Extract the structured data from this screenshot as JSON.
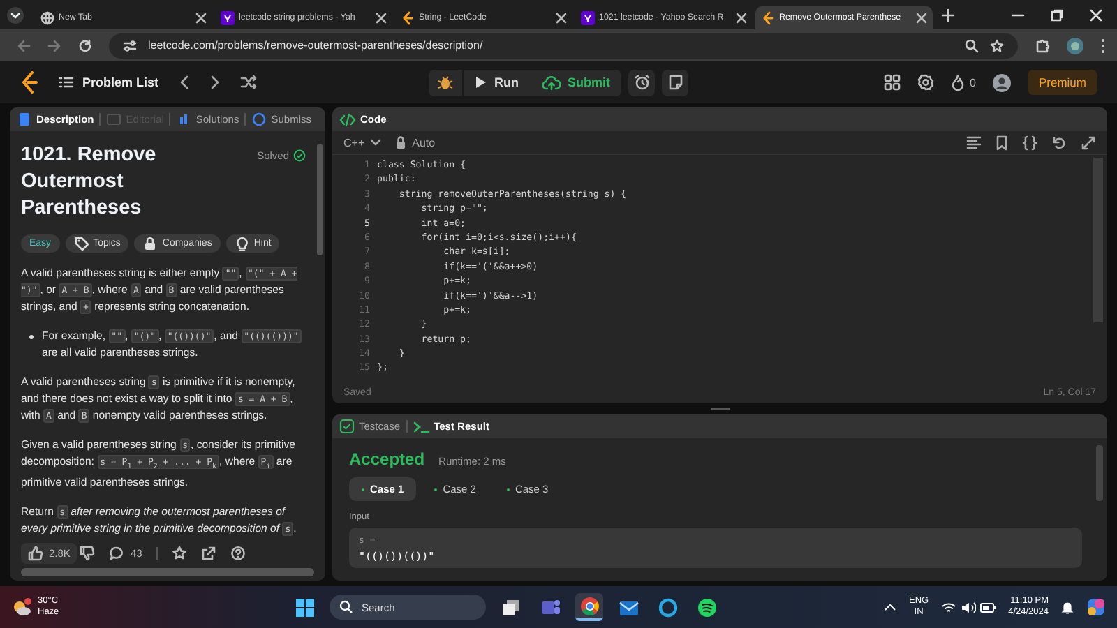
{
  "browser": {
    "tabs": [
      {
        "title": "New Tab",
        "kind": "globe",
        "selected": false
      },
      {
        "title": "leetcode string problems - Yah",
        "kind": "yahoo",
        "selected": false
      },
      {
        "title": "String - LeetCode",
        "kind": "leetcode",
        "selected": false
      },
      {
        "title": "1021 leetcode - Yahoo Search R",
        "kind": "yahoo",
        "selected": false
      },
      {
        "title": "Remove Outermost Parenthese",
        "kind": "leetcode",
        "selected": true
      }
    ],
    "url": "leetcode.com/problems/remove-outermost-parentheses/description/"
  },
  "nav": {
    "problem_list": "Problem List",
    "run": "Run",
    "submit": "Submit",
    "streak": "0",
    "premium": "Premium"
  },
  "description_panel": {
    "tabs": [
      {
        "label": "Description",
        "kind": "description",
        "selected": true,
        "disabled": false
      },
      {
        "label": "Editorial",
        "kind": "editorial",
        "selected": false,
        "disabled": true
      },
      {
        "label": "Solutions",
        "kind": "solutions",
        "selected": false,
        "disabled": false
      },
      {
        "label": "Submiss",
        "kind": "submissions",
        "selected": false,
        "disabled": false
      }
    ],
    "title": "1021. Remove Outermost Parentheses",
    "status": "Solved",
    "difficulty": "Easy",
    "tags": [
      {
        "label": "Topics",
        "kind": "topics"
      },
      {
        "label": "Companies",
        "kind": "companies"
      },
      {
        "label": "Hint",
        "kind": "hint"
      }
    ],
    "paragraphs": [
      {
        "kind": "paragraph",
        "segments": [
          {
            "kind": "text",
            "text": "A valid parentheses string is either empty "
          },
          {
            "kind": "code",
            "text": "\"\""
          },
          {
            "kind": "text",
            "text": ", "
          },
          {
            "kind": "code",
            "text": "\"(\" + A + \")\""
          },
          {
            "kind": "text",
            "text": ", or "
          },
          {
            "kind": "code",
            "text": "A + B"
          },
          {
            "kind": "text",
            "text": ", where "
          },
          {
            "kind": "code",
            "text": "A"
          },
          {
            "kind": "text",
            "text": " and "
          },
          {
            "kind": "code",
            "text": "B"
          },
          {
            "kind": "text",
            "text": " are valid parentheses strings, and "
          },
          {
            "kind": "code",
            "text": "+"
          },
          {
            "kind": "text",
            "text": " represents string concatenation."
          }
        ]
      },
      {
        "kind": "bullet",
        "segments": [
          {
            "kind": "text",
            "text": "For example, "
          },
          {
            "kind": "code",
            "text": "\"\""
          },
          {
            "kind": "text",
            "text": ", "
          },
          {
            "kind": "code",
            "text": "\"()\""
          },
          {
            "kind": "text",
            "text": ", "
          },
          {
            "kind": "code",
            "text": "\"(())()\""
          },
          {
            "kind": "text",
            "text": ", and "
          },
          {
            "kind": "code",
            "text": "\"(()(()))\""
          },
          {
            "kind": "text",
            "text": " are all valid parentheses strings."
          }
        ]
      },
      {
        "kind": "paragraph",
        "segments": [
          {
            "kind": "text",
            "text": "A valid parentheses string "
          },
          {
            "kind": "code",
            "text": "s"
          },
          {
            "kind": "text",
            "text": " is primitive if it is nonempty, and there does not exist a way to split it into "
          },
          {
            "kind": "code",
            "text": "s = A + B"
          },
          {
            "kind": "text",
            "text": ", with "
          },
          {
            "kind": "code",
            "text": "A"
          },
          {
            "kind": "text",
            "text": " and "
          },
          {
            "kind": "code",
            "text": "B"
          },
          {
            "kind": "text",
            "text": " nonempty valid parentheses strings."
          }
        ]
      },
      {
        "kind": "paragraph",
        "segments": [
          {
            "kind": "text",
            "text": "Given a valid parentheses string "
          },
          {
            "kind": "code",
            "text": "s"
          },
          {
            "kind": "text",
            "text": ", consider its primitive decomposition: "
          },
          {
            "kind": "code",
            "text": "s = P$_{1}$ + P$_{2}$ + ... + P$_{k}$"
          },
          {
            "kind": "text",
            "text": ", where "
          },
          {
            "kind": "code",
            "text": "P$_{i}$"
          },
          {
            "kind": "text",
            "text": " are primitive valid parentheses strings."
          }
        ]
      },
      {
        "kind": "paragraph",
        "segments": [
          {
            "kind": "text",
            "text": "Return "
          },
          {
            "kind": "code",
            "text": "s"
          },
          {
            "kind": "italic",
            "text": " after removing the outermost parentheses of every primitive string in the primitive decomposition of "
          },
          {
            "kind": "code",
            "text": "s"
          },
          {
            "kind": "text",
            "text": "."
          }
        ]
      }
    ],
    "likes": "2.8K",
    "comments": "43"
  },
  "code_panel": {
    "title": "Code",
    "language": "C++",
    "mode": "Auto",
    "lines": [
      {
        "number": "1",
        "text": "class Solution {",
        "current": false
      },
      {
        "number": "2",
        "text": "public:",
        "current": false
      },
      {
        "number": "3",
        "text": "    string removeOuterParentheses(string s) {",
        "current": false
      },
      {
        "number": "4",
        "text": "        string p=\"\";",
        "current": false
      },
      {
        "number": "5",
        "text": "        int a=0;",
        "current": true
      },
      {
        "number": "6",
        "text": "        for(int i=0;i<s.size();i++){",
        "current": false
      },
      {
        "number": "7",
        "text": "            char k=s[i];",
        "current": false
      },
      {
        "number": "8",
        "text": "            if(k=='('&&a++>0)",
        "current": false
      },
      {
        "number": "9",
        "text": "            p+=k;",
        "current": false
      },
      {
        "number": "10",
        "text": "            if(k==')'&&a-->1)",
        "current": false
      },
      {
        "number": "11",
        "text": "            p+=k;",
        "current": false
      },
      {
        "number": "12",
        "text": "        }",
        "current": false
      },
      {
        "number": "13",
        "text": "        return p;",
        "current": false
      },
      {
        "number": "14",
        "text": "    }",
        "current": false
      },
      {
        "number": "15",
        "text": "};",
        "current": false
      }
    ],
    "status": "Saved",
    "cursor": "Ln 5, Col 17"
  },
  "result_panel": {
    "tabs": [
      {
        "label": "Testcase",
        "kind": "testcase",
        "selected": false
      },
      {
        "label": "Test Result",
        "kind": "result",
        "selected": true
      }
    ],
    "verdict": "Accepted",
    "runtime": "Runtime: 2 ms",
    "cases": [
      {
        "label": "Case 1",
        "selected": true
      },
      {
        "label": "Case 2",
        "selected": false
      },
      {
        "label": "Case 3",
        "selected": false
      }
    ],
    "input_label": "Input",
    "parameter": "s =",
    "value": "\"(()())(())\""
  },
  "taskbar": {
    "temperature": "30°C",
    "weather": "Haze",
    "search": "Search",
    "language": "ENG",
    "region": "IN",
    "time": "11:10 PM",
    "date": "4/24/2024",
    "apps": [
      {
        "kind": "windows",
        "selected": false
      },
      {
        "kind": "taskview",
        "selected": false
      },
      {
        "kind": "teams",
        "selected": false
      },
      {
        "kind": "chrome",
        "selected": true
      },
      {
        "kind": "mail",
        "selected": false
      },
      {
        "kind": "cortana",
        "selected": false
      },
      {
        "kind": "spotify",
        "selected": false
      }
    ]
  }
}
